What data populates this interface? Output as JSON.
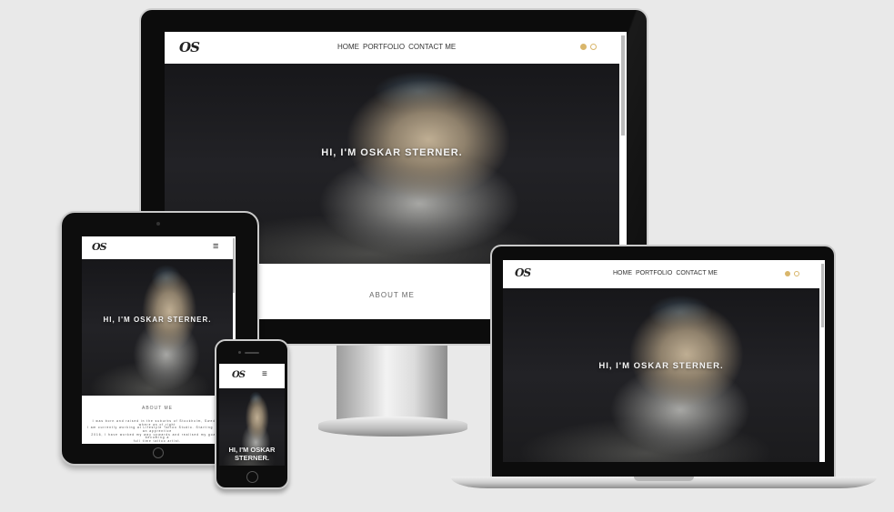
{
  "site": {
    "logo": "OS",
    "nav": {
      "home": "HOME",
      "portfolio": "PORTFOLIO",
      "contact": "CONTACT ME"
    },
    "menu_icon": "≡",
    "hero_title": "HI, I'M OSKAR STERNER.",
    "about_heading": "ABOUT ME",
    "about_lines": [
      "I was born and raised in the suburbs of Stockholm, Sweden, where as of right",
      "I am currently working at Lifestyle Tattoo Studio. Starting off as an apprentice",
      "2016, I have worked my way upwards and realised my goal of becoming a",
      "full time tattoo artist."
    ],
    "social_icons": [
      "facebook-icon",
      "instagram-icon"
    ]
  },
  "devices": [
    "desktop-monitor",
    "tablet",
    "smartphone",
    "laptop"
  ],
  "colors": {
    "accent": "#d9b66b",
    "background": "#e9e9e9"
  }
}
